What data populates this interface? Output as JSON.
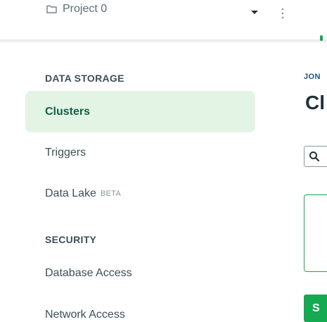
{
  "topbar": {
    "project_name": "Project 0"
  },
  "sidebar": {
    "sections": [
      {
        "header": "DATA STORAGE",
        "items": [
          {
            "label": "Clusters",
            "active": true
          },
          {
            "label": "Triggers"
          },
          {
            "label": "Data Lake",
            "badge": "BETA"
          }
        ]
      },
      {
        "header": "SECURITY",
        "items": [
          {
            "label": "Database Access"
          },
          {
            "label": "Network Access"
          }
        ]
      }
    ]
  },
  "main": {
    "breadcrumb": "JON",
    "title": "Cl",
    "button_label": "S"
  },
  "icons": {
    "project": "folder-icon",
    "project_menu": "caret-down-icon",
    "more": "vertical-dots-icon",
    "search": "search-icon"
  },
  "colors": {
    "accent_green": "#13aa52",
    "active_bg": "#e4f4e4",
    "active_text": "#116149",
    "breadcrumb_blue": "#1a567e"
  }
}
